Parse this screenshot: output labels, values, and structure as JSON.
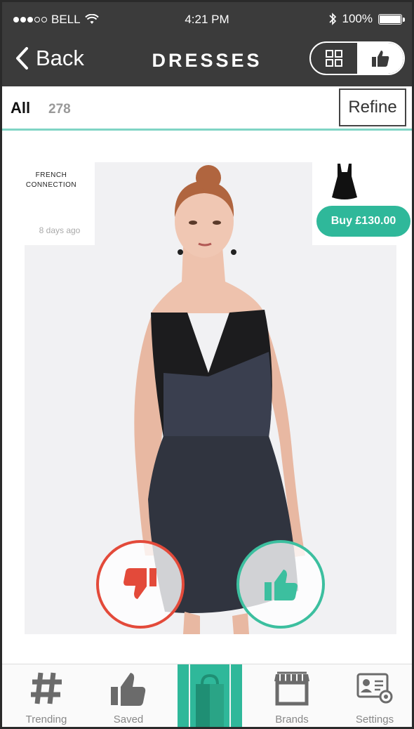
{
  "status_bar": {
    "carrier": "BELL",
    "time": "4:21 PM",
    "battery": "100%"
  },
  "nav": {
    "back_label": "Back",
    "title": "DRESSES"
  },
  "filter": {
    "all_label": "All",
    "count": "278",
    "refine_label": "Refine"
  },
  "product": {
    "brand_line1": "FRENCH",
    "brand_line2": "CONNECTION",
    "posted": "8 days ago",
    "buy_label": "Buy £130.00"
  },
  "tabs": [
    {
      "label": "Trending",
      "icon": "hash-icon"
    },
    {
      "label": "Saved",
      "icon": "thumbs-up-icon"
    },
    {
      "label": "",
      "icon": "shopping-bag-icon"
    },
    {
      "label": "Brands",
      "icon": "storefront-icon"
    },
    {
      "label": "Settings",
      "icon": "id-card-gear-icon"
    }
  ],
  "colors": {
    "bar_bg": "#3b3b3b",
    "accent_teal": "#2fb89a",
    "dislike_red": "#e34a3a"
  }
}
